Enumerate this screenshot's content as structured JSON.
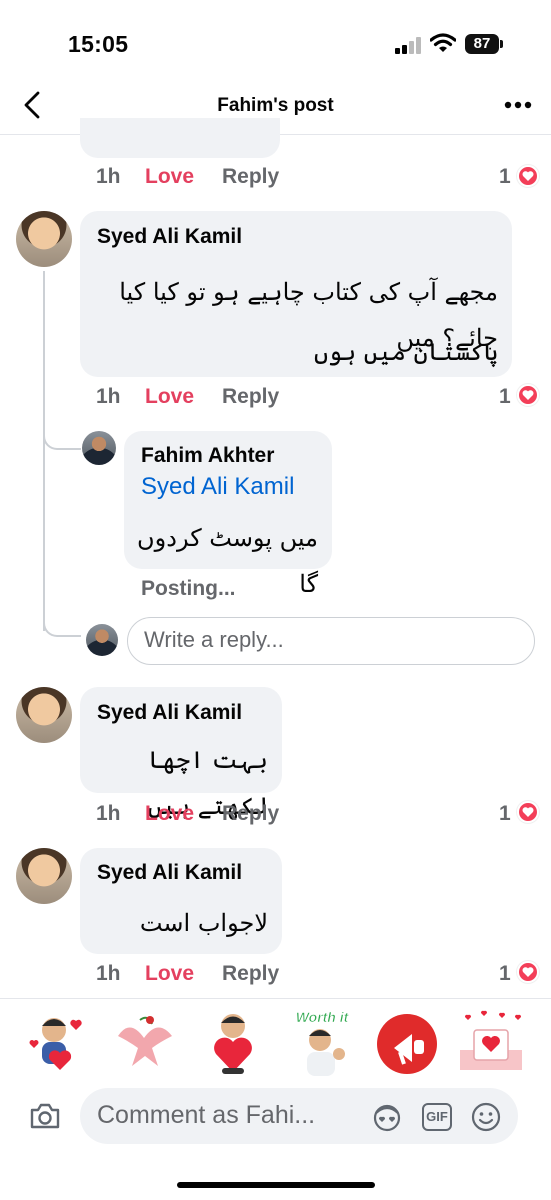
{
  "status": {
    "time": "15:05",
    "battery": "87"
  },
  "header": {
    "title": "Fahim's post"
  },
  "top_row": {
    "time": "1h",
    "love": "Love",
    "reply": "Reply",
    "count": "1"
  },
  "comment1": {
    "name": "Syed Ali Kamil",
    "line1": "مجھے آپ کی کتاب چاہیے ہو تو کیا کیا جائے؟ میں",
    "line2": "پاکستان میں ہوں",
    "time": "1h",
    "love": "Love",
    "reply": "Reply",
    "count": "1"
  },
  "reply1": {
    "name": "Fahim Akhter",
    "tag": "Syed Ali Kamil",
    "text": "میں پوسٹ کردوں گا",
    "status": "Posting..."
  },
  "reply_input": {
    "placeholder": "Write a reply..."
  },
  "comment2": {
    "name": "Syed Ali Kamil",
    "text": "بہت اچھا لکھتے ہیں",
    "time": "1h",
    "love": "Love",
    "reply": "Reply",
    "count": "1"
  },
  "comment3": {
    "name": "Syed Ali Kamil",
    "text": "لاجواب است",
    "time": "1h",
    "love": "Love",
    "reply": "Reply",
    "count": "1"
  },
  "stickers": [
    {
      "name": "hug-hearts-sticker"
    },
    {
      "name": "dove-sticker"
    },
    {
      "name": "heart-hug-sticker"
    },
    {
      "name": "worth-it-sticker",
      "caption": "Worth it"
    },
    {
      "name": "megaphone-sticker"
    },
    {
      "name": "love-letter-sticker"
    }
  ],
  "composer": {
    "placeholder": "Comment as Fahi...",
    "gif": "GIF"
  },
  "colors": {
    "love": "#e4405f",
    "link": "#0064d1",
    "bubble": "#f0f2f5"
  }
}
